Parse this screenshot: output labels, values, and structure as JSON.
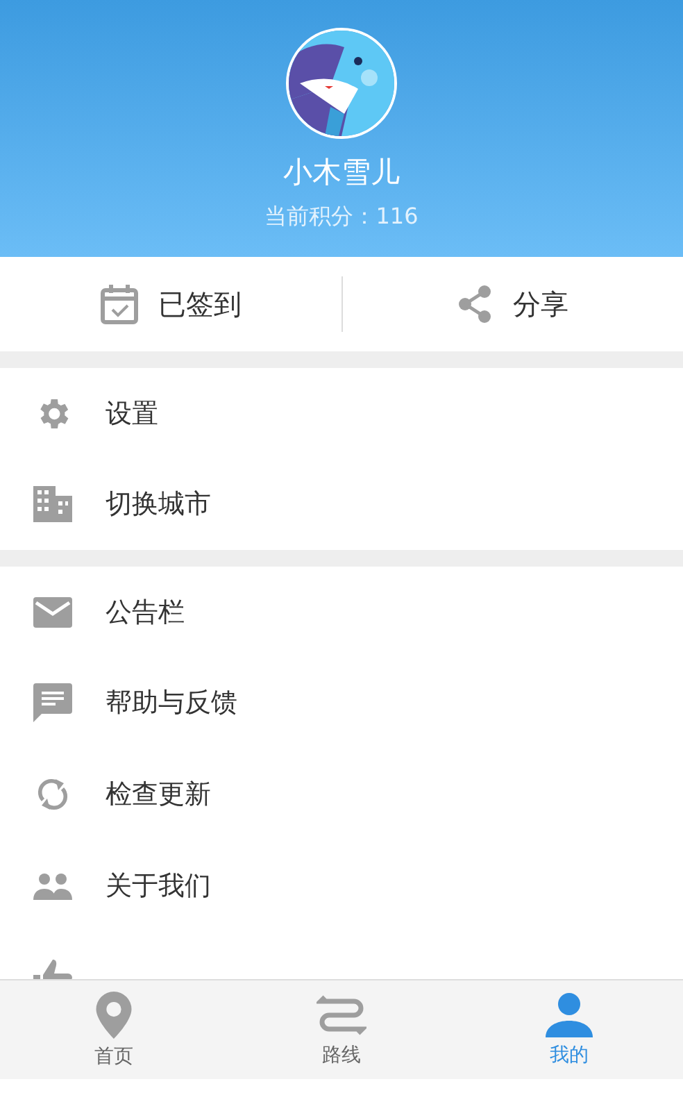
{
  "profile": {
    "name": "小木雪儿",
    "points": "当前积分：116"
  },
  "actions": [
    {
      "kind": "calendar",
      "label": "已签到"
    },
    {
      "kind": "share",
      "label": "分享"
    }
  ],
  "menu_groups": [
    [
      {
        "kind": "gear",
        "label": "设置"
      },
      {
        "kind": "building",
        "label": "切换城市"
      }
    ],
    [
      {
        "kind": "mail",
        "label": "公告栏"
      },
      {
        "kind": "chat",
        "label": "帮助与反馈"
      },
      {
        "kind": "sync",
        "label": "检查更新"
      },
      {
        "kind": "people",
        "label": "关于我们"
      },
      {
        "kind": "thumb"
      }
    ]
  ],
  "bottom_nav": [
    {
      "kind": "pin",
      "label": "首页",
      "selected": false
    },
    {
      "kind": "route",
      "label": "路线",
      "selected": false
    },
    {
      "kind": "person",
      "label": "我的",
      "selected": true
    }
  ]
}
